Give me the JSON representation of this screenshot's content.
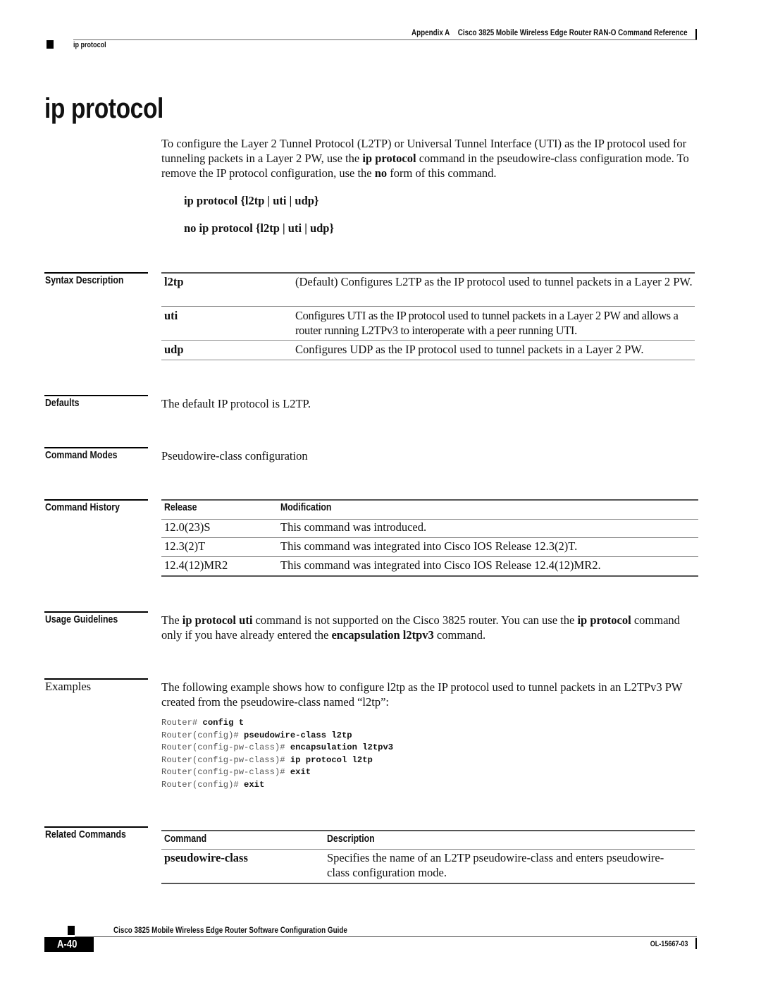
{
  "running_header": {
    "appendix": "Appendix A",
    "book_title": "Cisco 3825 Mobile Wireless Edge Router RAN-O Command Reference",
    "section": "ip protocol"
  },
  "title": "ip protocol",
  "intro": {
    "parts": [
      {
        "text": "To configure the Layer 2 Tunnel Protocol (L2TP) or Universal Tunnel Interface (UTI) as the IP protocol used for tunneling packets in a Layer 2 PW, use the ",
        "bold": false
      },
      {
        "text": "ip protocol",
        "bold": true
      },
      {
        "text": " command in the pseudowire-class configuration mode. To remove the IP protocol configuration, use the ",
        "bold": false
      },
      {
        "text": "no",
        "bold": true
      },
      {
        "text": " form of this command.",
        "bold": false
      }
    ]
  },
  "syntax": {
    "line1": "ip protocol {l2tp | uti | udp}",
    "line2": "no ip protocol {l2tp | uti | udp}"
  },
  "syntax_description": {
    "label": "Syntax Description",
    "rows": [
      {
        "keyword": "l2tp",
        "description": "(Default) Configures L2TP as the IP protocol used to tunnel packets in a Layer 2 PW."
      },
      {
        "keyword": "uti",
        "description": "Configures UTI as the IP protocol used to tunnel packets in a Layer 2 PW and allows a router running L2TPv3 to interoperate with a peer running UTI."
      },
      {
        "keyword": "udp",
        "description": "Configures UDP as the IP protocol used to tunnel packets in a Layer 2 PW."
      }
    ]
  },
  "defaults": {
    "label": "Defaults",
    "text": "The default IP protocol is L2TP."
  },
  "command_modes": {
    "label": "Command Modes",
    "text": "Pseudowire-class configuration"
  },
  "command_history": {
    "label": "Command History",
    "headers": [
      "Release",
      "Modification"
    ],
    "rows": [
      {
        "release": "12.0(23)S",
        "modification": "This command was introduced."
      },
      {
        "release": "12.3(2)T",
        "modification": "This command was integrated into Cisco IOS Release 12.3(2)T."
      },
      {
        "release": "12.4(12)MR2",
        "modification": "This command was integrated into Cisco IOS Release 12.4(12)MR2."
      }
    ]
  },
  "usage_guidelines": {
    "label": "Usage Guidelines",
    "parts": [
      {
        "text": "The ",
        "bold": false
      },
      {
        "text": "ip protocol uti",
        "bold": true
      },
      {
        "text": " command is not supported on the Cisco 3825 router. You can use the ",
        "bold": false
      },
      {
        "text": "ip protocol",
        "bold": true
      },
      {
        "text": " command only if you have already entered the ",
        "bold": false
      },
      {
        "text": "encapsulation l2tpv3",
        "bold": true
      },
      {
        "text": " command.",
        "bold": false
      }
    ]
  },
  "examples": {
    "label": "Examples",
    "text": "The following example shows how to configure l2tp as the IP protocol used to tunnel packets in an L2TPv3 PW created from the pseudowire-class named “l2tp”:",
    "code": [
      {
        "prompt": "Router# ",
        "command": "config t"
      },
      {
        "prompt": "Router(config)# ",
        "command": "pseudowire-class l2tp"
      },
      {
        "prompt": "Router(config-pw-class)# ",
        "command": "encapsulation l2tpv3"
      },
      {
        "prompt": "Router(config-pw-class)# ",
        "command": "ip protocol l2tp"
      },
      {
        "prompt": "Router(config-pw-class)# ",
        "command": "exit"
      },
      {
        "prompt": "Router(config)# ",
        "command": "exit"
      }
    ]
  },
  "related_commands": {
    "label": "Related Commands",
    "headers": [
      "Command",
      "Description"
    ],
    "rows": [
      {
        "command": "pseudowire-class",
        "description": "Specifies the name of an L2TP pseudowire-class and enters pseudowire-class configuration mode."
      }
    ]
  },
  "footer": {
    "guide_title": "Cisco 3825 Mobile Wireless Edge Router Software Configuration Guide",
    "page_number": "A-40",
    "doc_number": "OL-15667-03"
  }
}
